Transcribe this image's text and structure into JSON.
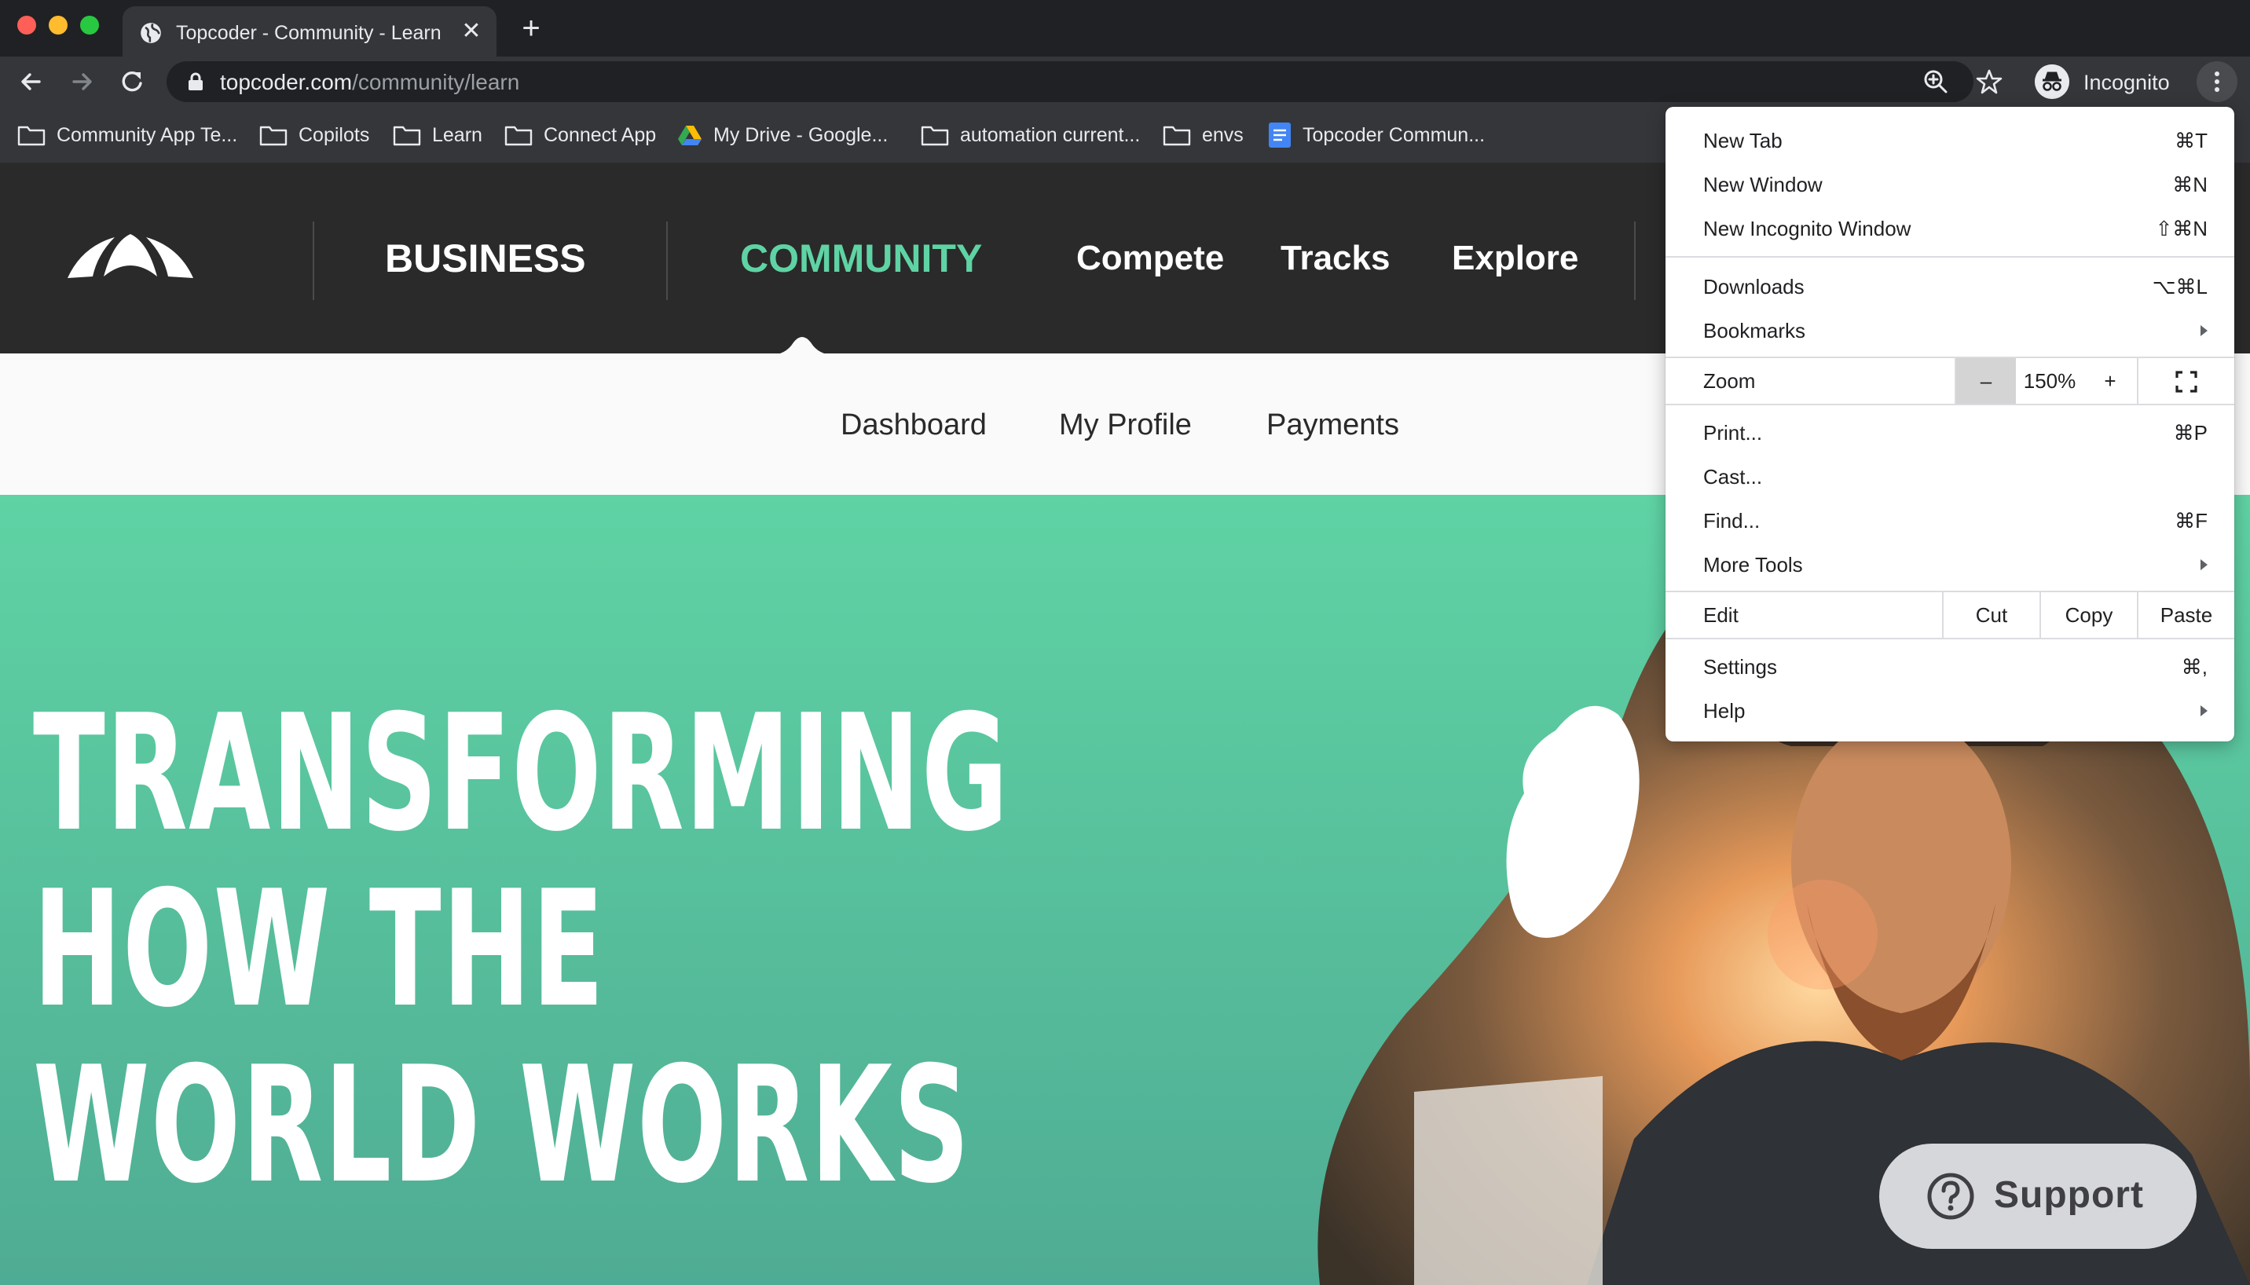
{
  "browser": {
    "tab_title": "Topcoder - Community - Learn",
    "new_tab_symbol": "+",
    "close_symbol": "✕",
    "url_host": "topcoder.com",
    "url_path": "/community/learn",
    "profile_label": "Incognito"
  },
  "bookmarks": [
    {
      "label": "Community App Te...",
      "icon": "folder-icon"
    },
    {
      "label": "Copilots",
      "icon": "folder-icon"
    },
    {
      "label": "Learn",
      "icon": "folder-icon"
    },
    {
      "label": "Connect App",
      "icon": "folder-icon"
    },
    {
      "label": "My Drive - Google...",
      "icon": "google-drive-icon"
    },
    {
      "label": "automation current...",
      "icon": "folder-icon"
    },
    {
      "label": "envs",
      "icon": "folder-icon"
    },
    {
      "label": "Topcoder Commun...",
      "icon": "google-docs-icon"
    }
  ],
  "site_nav": {
    "business": "BUSINESS",
    "community": "COMMUNITY",
    "compete": "Compete",
    "tracks": "Tracks",
    "explore": "Explore"
  },
  "subnav": {
    "dashboard": "Dashboard",
    "my_profile": "My Profile",
    "payments": "Payments"
  },
  "hero": {
    "line1": "TRANSFORMING",
    "line2": "HOW THE",
    "line3": "WORLD WORKS"
  },
  "support_label": "Support",
  "menu": {
    "new_tab": {
      "label": "New Tab",
      "shortcut": "⌘T"
    },
    "new_window": {
      "label": "New Window",
      "shortcut": "⌘N"
    },
    "new_incognito": {
      "label": "New Incognito Window",
      "shortcut": "⇧⌘N"
    },
    "downloads": {
      "label": "Downloads",
      "shortcut": "⌥⌘L"
    },
    "bookmarks": {
      "label": "Bookmarks"
    },
    "zoom": {
      "label": "Zoom",
      "minus": "–",
      "value": "150%",
      "plus": "+"
    },
    "print": {
      "label": "Print...",
      "shortcut": "⌘P"
    },
    "cast": {
      "label": "Cast..."
    },
    "find": {
      "label": "Find...",
      "shortcut": "⌘F"
    },
    "more_tools": {
      "label": "More Tools"
    },
    "edit": {
      "label": "Edit",
      "cut": "Cut",
      "copy": "Copy",
      "paste": "Paste"
    },
    "settings": {
      "label": "Settings",
      "shortcut": "⌘,"
    },
    "help": {
      "label": "Help"
    }
  },
  "colors": {
    "brand_green": "#5fd3a4",
    "header_dark": "#2a2a2a",
    "chrome_dark": "#202124"
  }
}
